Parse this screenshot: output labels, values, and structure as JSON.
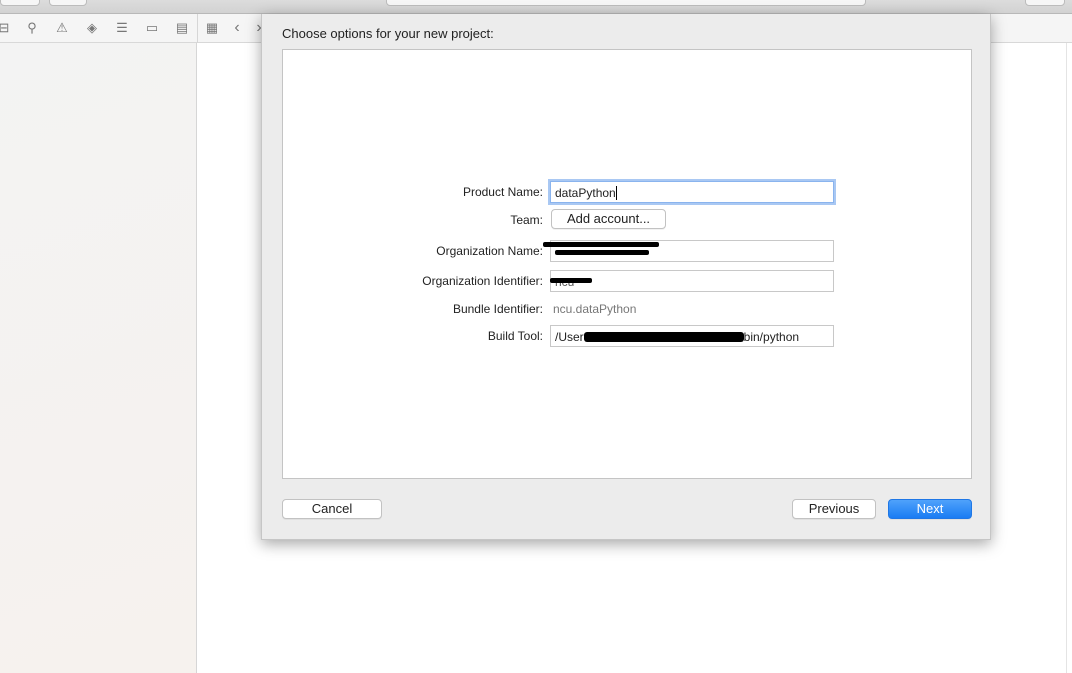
{
  "dialog": {
    "title": "Choose options for your new project:",
    "fields": {
      "product_name": {
        "label": "Product Name:",
        "value": "dataPython"
      },
      "team": {
        "label": "Team:",
        "button": "Add account..."
      },
      "organization_name": {
        "label": "Organization Name:",
        "value": ""
      },
      "organization_identifier": {
        "label": "Organization Identifier:",
        "value": "ncu"
      },
      "bundle_identifier": {
        "label": "Bundle Identifier:",
        "value": "ncu.dataPython"
      },
      "build_tool": {
        "label": "Build Tool:",
        "value_start": "/User",
        "value_end": "bin/python"
      }
    },
    "buttons": {
      "cancel": "Cancel",
      "previous": "Previous",
      "next": "Next"
    }
  },
  "navigator_icons": [
    "hierarchy-icon",
    "search-icon",
    "warning-icon",
    "test-diamond-icon",
    "debug-list-icon",
    "breakpoint-icon",
    "report-icon"
  ],
  "editor_icons": [
    "grid-icon",
    "chevron-left-icon",
    "chevron-right-icon"
  ],
  "colors": {
    "accent": "#1a7cf3",
    "focus_ring": "#a9c8f3"
  }
}
